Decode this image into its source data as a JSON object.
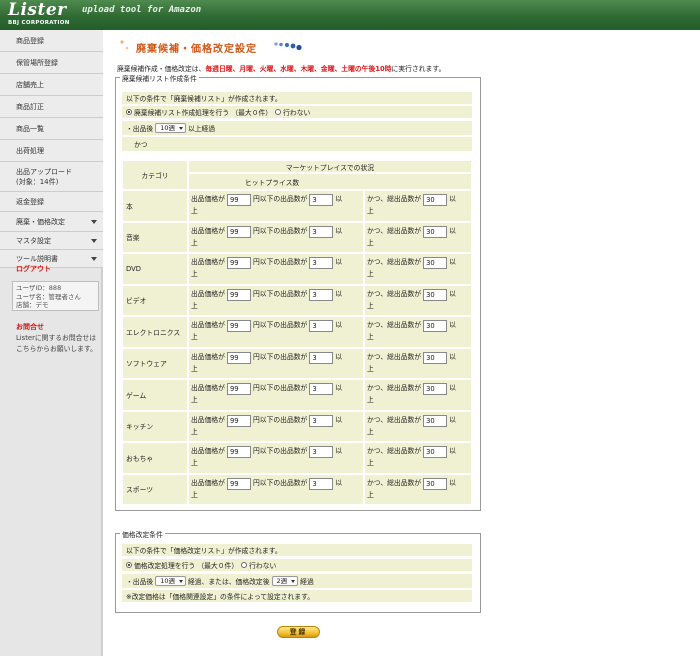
{
  "header": {
    "logo": "Lister",
    "tagline": "upload tool for Amazon",
    "corp": "BBJ CORPORATION",
    "colors": {
      "header_green": "#2f6a33",
      "accent_orange": "#d05a18",
      "alert_red": "#e01818",
      "row_bg": "#f0f0d2"
    }
  },
  "sidebar": {
    "items": [
      {
        "label": "商品登録"
      },
      {
        "label": "保管場所登録"
      },
      {
        "label": "店舗売上"
      },
      {
        "label": "商品訂正"
      },
      {
        "label": "商品一覧"
      },
      {
        "label": "出荷処理"
      },
      {
        "label": "出品アップロード",
        "label2": "(対象：14件)"
      },
      {
        "label": "返金登録"
      },
      {
        "label": "廃棄・価格改定",
        "dropdown": true
      },
      {
        "label": "マスタ設定",
        "dropdown": true
      },
      {
        "label": "ツール説明書",
        "dropdown": true
      }
    ],
    "logout": "ログアウト",
    "user": {
      "id_line": "ユーザID：888",
      "name_line": "ユーザ名：管理者さん",
      "store_line": "店舗：デモ"
    },
    "contact": {
      "title": "お問合せ",
      "line1": "Listerに関するお問合せは",
      "line2": "こちらからお願いします。"
    }
  },
  "main": {
    "title": "廃棄候補・価格改定設定",
    "note_prefix": "廃棄候補作成・価格改定は、",
    "note_days": "毎週日曜、月曜、火曜、水曜、木曜、金曜、土曜の午後10時",
    "note_suffix": "に実行されます。",
    "disposal": {
      "legend": "廃棄候補リスト作成条件",
      "intro": "以下の条件で「廃棄候補リスト」が作成されます。",
      "radio_on": "廃棄候補リスト作成処理を行う （最大０件）",
      "radio_off": "行わない",
      "period_prefix": "・出品後",
      "period_value": "10週",
      "period_suffix": "以上経過",
      "and": "かつ",
      "col_category": "カテゴリ",
      "col_market": "マーケットプレイスでの状況",
      "col_hit": "ヒットプライス数",
      "crit_a1": "出品価格が",
      "crit_a2": "円以下の出品数が",
      "crit_a3": "以",
      "crit_a4": "上",
      "crit_b1": "かつ、総出品数が",
      "crit_b2": "以",
      "crit_b3": "上",
      "rows": [
        {
          "category": "本",
          "price": "99",
          "count": "3",
          "total": "30"
        },
        {
          "category": "音楽",
          "price": "99",
          "count": "3",
          "total": "30"
        },
        {
          "category": "DVD",
          "price": "99",
          "count": "3",
          "total": "30"
        },
        {
          "category": "ビデオ",
          "price": "99",
          "count": "3",
          "total": "30"
        },
        {
          "category": "エレクトロニクス",
          "price": "99",
          "count": "3",
          "total": "30"
        },
        {
          "category": "ソフトウェア",
          "price": "99",
          "count": "3",
          "total": "30"
        },
        {
          "category": "ゲーム",
          "price": "99",
          "count": "3",
          "total": "30"
        },
        {
          "category": "キッチン",
          "price": "99",
          "count": "3",
          "total": "30"
        },
        {
          "category": "おもちゃ",
          "price": "99",
          "count": "3",
          "total": "30"
        },
        {
          "category": "スポーツ",
          "price": "99",
          "count": "3",
          "total": "30"
        }
      ]
    },
    "price_revision": {
      "legend": "価格改定条件",
      "intro": "以下の条件で「価格改定リスト」が作成されます。",
      "radio_on": "価格改定処理を行う （最大０件）",
      "radio_off": "行わない",
      "cond_prefix": "・出品後",
      "cond_value1": "10週",
      "cond_mid": "経過、または、価格改定後",
      "cond_value2": "2週",
      "cond_suffix": "経過",
      "footnote": "※改定価格は「価格関連設定」の条件によって設定されます。"
    },
    "submit": "登録"
  }
}
